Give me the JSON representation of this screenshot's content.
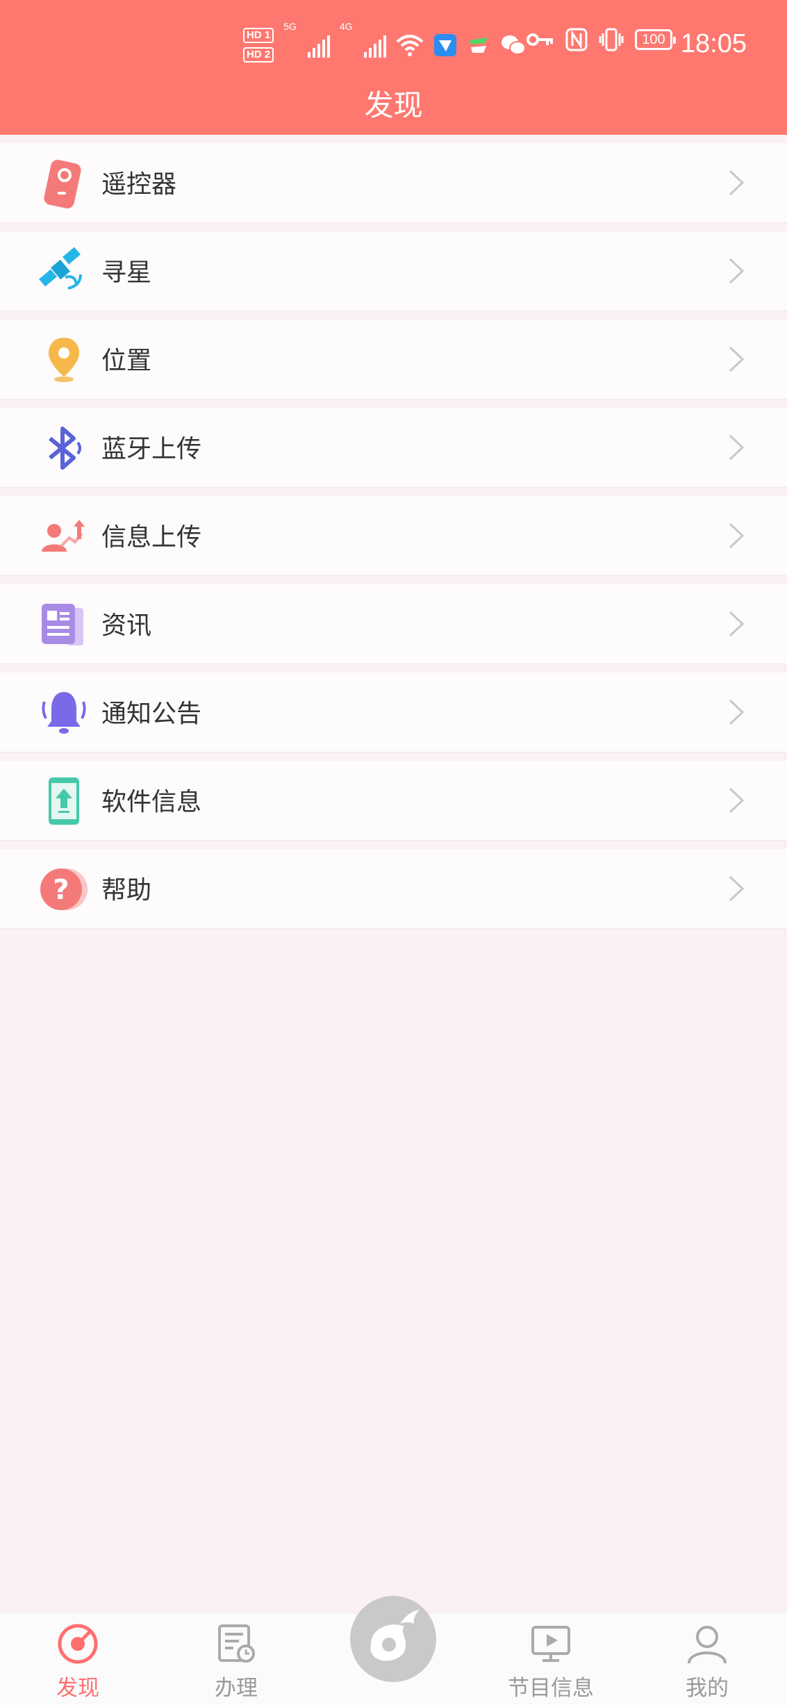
{
  "status_bar": {
    "time": "18:05",
    "sim1": "HD 1",
    "sim2": "HD 2",
    "net1": "5G",
    "net2": "4G",
    "battery": "100",
    "icons": [
      "signal-icon",
      "wifi-icon",
      "app-notification-icon",
      "app-notification-icon-2",
      "wechat-icon",
      "key-icon",
      "nfc-icon",
      "vibrate-icon",
      "battery-icon"
    ]
  },
  "header": {
    "title": "发现",
    "color": "#fe7870"
  },
  "menu": {
    "items": [
      {
        "label": "遥控器",
        "icon": "remote-control-icon"
      },
      {
        "label": "寻星",
        "icon": "satellite-icon"
      },
      {
        "label": "位置",
        "icon": "location-pin-icon"
      },
      {
        "label": "蓝牙上传",
        "icon": "bluetooth-icon"
      },
      {
        "label": "信息上传",
        "icon": "user-upload-icon"
      },
      {
        "label": "资讯",
        "icon": "newspaper-icon"
      },
      {
        "label": "通知公告",
        "icon": "bell-icon"
      },
      {
        "label": "软件信息",
        "icon": "phone-upload-icon"
      },
      {
        "label": "帮助",
        "icon": "help-icon"
      }
    ]
  },
  "tabbar": {
    "tabs": [
      {
        "label": "发现",
        "icon": "discover-icon",
        "active": true
      },
      {
        "label": "办理",
        "icon": "document-clock-icon",
        "active": false
      },
      {
        "label": "节目信息",
        "icon": "tv-play-icon",
        "active": false
      },
      {
        "label": "我的",
        "icon": "user-icon",
        "active": false
      }
    ],
    "center_icon": "brand-logo-icon",
    "active_color": "#ff6f6f",
    "inactive_color": "#999999"
  }
}
